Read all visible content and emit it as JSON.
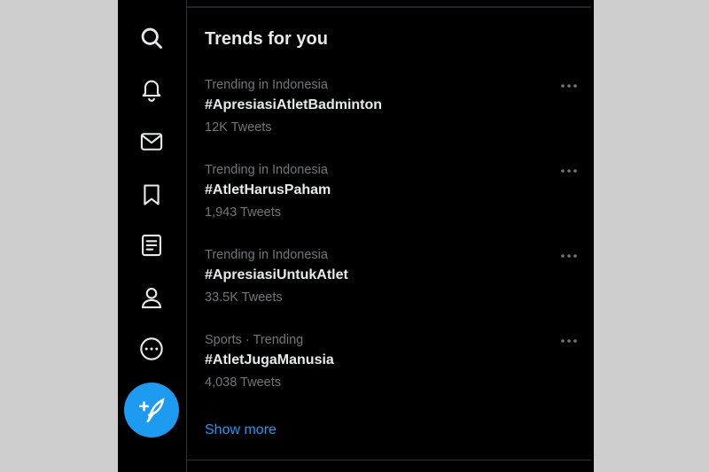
{
  "theme": {
    "background": "#000000",
    "text": "#e7e9ea",
    "muted": "#71767b",
    "accent": "#1d9bf0"
  },
  "nav": {
    "icons": [
      "search-icon",
      "bell-icon",
      "mail-icon",
      "bookmark-icon",
      "list-icon",
      "profile-icon",
      "more-circle-icon"
    ],
    "compose_icon": "feather-plus-icon"
  },
  "trends": {
    "heading": "Trends for you",
    "items": [
      {
        "context": "Trending in Indonesia",
        "tag": "#ApresiasiAtletBadminton",
        "count": "12K Tweets"
      },
      {
        "context": "Trending in Indonesia",
        "tag": "#AtletHarusPaham",
        "count": "1,943 Tweets"
      },
      {
        "context": "Trending in Indonesia",
        "tag": "#ApresiasiUntukAtlet",
        "count": "33.5K Tweets"
      },
      {
        "context": "Sports · Trending",
        "tag": "#AtletJugaManusia",
        "count": "4,038 Tweets"
      }
    ],
    "show_more": "Show more"
  }
}
